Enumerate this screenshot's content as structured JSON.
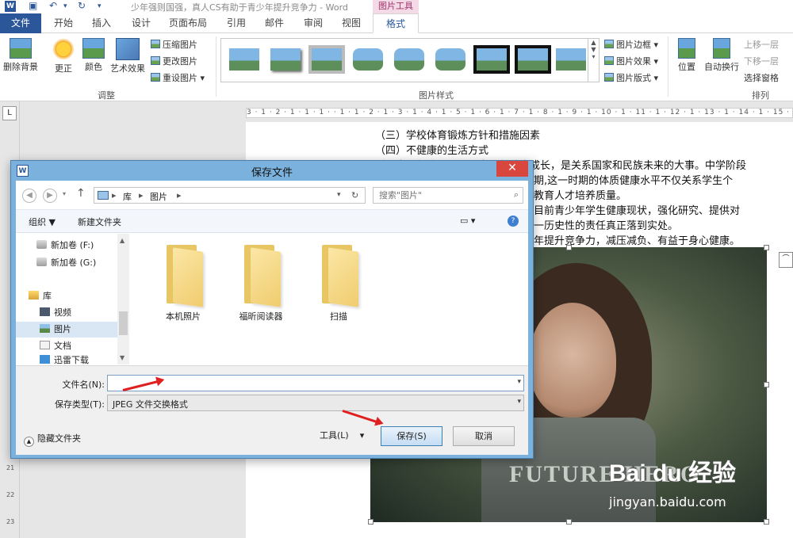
{
  "titlebar": {
    "document_title": "少年强则国强，真人CS有助于青少年提升竞争力 - Word",
    "contextual_tab": "图片工具"
  },
  "ribbon_tabs": [
    "文件",
    "开始",
    "插入",
    "设计",
    "页面布局",
    "引用",
    "邮件",
    "审阅",
    "视图",
    "格式"
  ],
  "ribbon": {
    "remove_bg": "删除背景",
    "corrections": "更正",
    "color": "颜色",
    "artistic": "艺术效果",
    "compress": "压缩图片",
    "change": "更改图片",
    "reset": "重设图片",
    "adjust_group": "调整",
    "styles_group": "图片样式",
    "border": "图片边框",
    "effects": "图片效果",
    "layout": "图片版式",
    "position": "位置",
    "wrap": "自动换行",
    "bring_forward": "上移一层",
    "send_backward": "下移一层",
    "selection_pane": "选择窗格",
    "arrange_group": "排列"
  },
  "ruler_top": "3 · 1 · 2 · 1 · 1 · 1 · · 1 · 1 · 2 · 1 · 3 · 1 · 4 · 1 · 5 · 1 · 6 · 1 · 7 · 1 · 8 · 1 · 9 · 1 · 10 · 1 · 11 · 1 · 12 · 1 · 13 · 1 · 14 · 1 · 15 · 1 · 16",
  "ruler_left_numbers": [
    "21",
    "22",
    "23"
  ],
  "document": {
    "lines": [
      "（三）学校体育锻炼方针和措施因素",
      "（四）不健康的生活方式",
      "增强青少年体质，促进青少年健康成长，是关系国家和民族未来的大事。中学阶段",
      "期,这一时期的体质健康水平不仅关系学生个",
      "教育人才培养质量。",
      "目前青少年学生健康现状，强化研究、提供对",
      "一历史性的责任真正落到实处。",
      "年提升竞争力，减压减负、有益于身心健康。"
    ],
    "photo_text": "FUTURE HERO"
  },
  "watermark": {
    "brand": "Bai du 经验",
    "url": "jingyan.baidu.com"
  },
  "dialog": {
    "title": "保存文件",
    "close_glyph": "✕",
    "breadcrumbs": [
      "库",
      "图片"
    ],
    "search_placeholder": "搜索\"图片\"",
    "organize": "组织 ▼",
    "new_folder": "新建文件夹",
    "nav_items": [
      "新加卷 (F:)",
      "新加卷 (G:)",
      "库",
      "视频",
      "图片",
      "文档",
      "迅雷下载"
    ],
    "folders": [
      "本机照片",
      "福昕阅读器",
      "扫描"
    ],
    "filename_label": "文件名(N):",
    "filename_value": "",
    "filetype_label": "保存类型(T):",
    "filetype_value": "JPEG 文件交换格式",
    "hide_folders": "隐藏文件夹",
    "tools": "工具(L)",
    "save": "保存(S)",
    "cancel": "取消"
  },
  "colors": {
    "word_blue": "#2b579a",
    "dialog_frame": "#7ab2dd",
    "close_red": "#d9463e",
    "annotation_red": "#e02020"
  }
}
